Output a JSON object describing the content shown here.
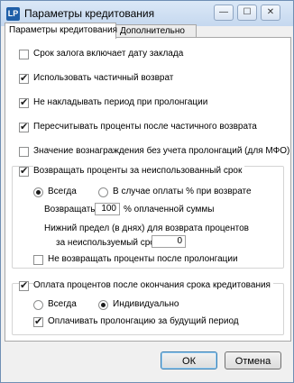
{
  "window": {
    "title": "Параметры кредитования",
    "icon_text": "LP"
  },
  "tabs": [
    {
      "label": "Параметры кредитования"
    },
    {
      "label": "Дополнительно"
    }
  ],
  "options": {
    "pledge_includes_date": {
      "label": "Срок залога включает дату заклада",
      "checked": false
    },
    "partial_return": {
      "label": "Использовать частичный возврат",
      "checked": true
    },
    "no_overlay": {
      "label": "Не накладывать период при пролонгации",
      "checked": true
    },
    "recalc": {
      "label": "Пересчитывать проценты после частичного возврата",
      "checked": true
    },
    "mfo": {
      "label": "Значение вознаграждения без учета пролонгаций (для МФО)",
      "checked": false
    }
  },
  "return_group": {
    "checkbox": {
      "label": "Возвращать проценты за неиспользованный срок",
      "checked": true
    },
    "radio_always": {
      "label": "Всегда",
      "selected": true
    },
    "radio_on_payment": {
      "label": "В случае оплаты % при возврате",
      "selected": false
    },
    "return_label": "Возвращать",
    "return_percent": "100",
    "return_suffix": "% оплаченной суммы",
    "lower_limit_label_1": "Нижний предел (в днях) для возврата процентов",
    "lower_limit_label_2": "за неиспользуемый срок",
    "lower_limit_value": "0",
    "no_return_after_prolong": {
      "label": "Не возвращать проценты после пролонгации",
      "checked": false
    }
  },
  "after_term_group": {
    "checkbox": {
      "label": "Оплата процентов после окончания срока кредитования",
      "checked": true
    },
    "radio_always": {
      "label": "Всегда",
      "selected": false
    },
    "radio_individual": {
      "label": "Индивидуально",
      "selected": true
    },
    "pay_future": {
      "label": "Оплачивать пролонгацию за будущий период",
      "checked": true
    }
  },
  "buttons": {
    "ok": "ОК",
    "cancel": "Отмена"
  },
  "titlebar_buttons": {
    "minimize": "—",
    "maximize": "☐",
    "close": "✕"
  }
}
